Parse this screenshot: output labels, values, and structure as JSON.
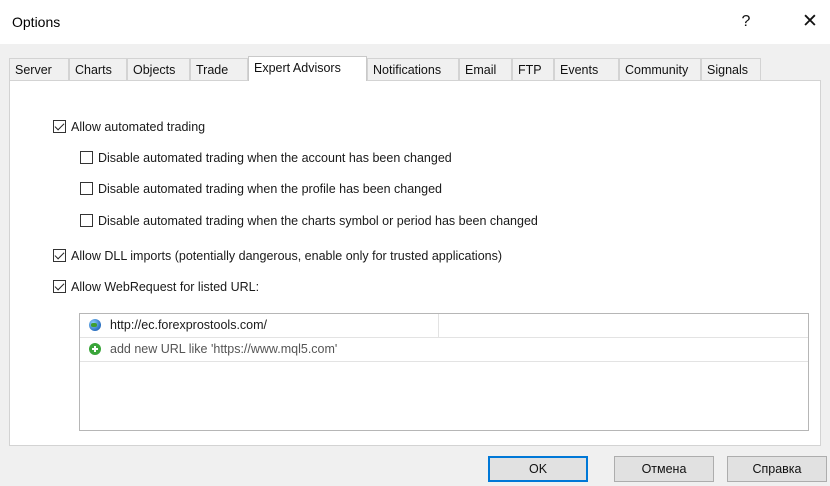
{
  "window": {
    "title": "Options",
    "help_label": "?",
    "close_label": "✕"
  },
  "tabs": [
    {
      "label": "Server"
    },
    {
      "label": "Charts"
    },
    {
      "label": "Objects"
    },
    {
      "label": "Trade"
    },
    {
      "label": "Expert Advisors",
      "active": true
    },
    {
      "label": "Notifications"
    },
    {
      "label": "Email"
    },
    {
      "label": "FTP"
    },
    {
      "label": "Events"
    },
    {
      "label": "Community"
    },
    {
      "label": "Signals"
    }
  ],
  "options": {
    "allow_automated": {
      "label": "Allow automated trading",
      "checked": true
    },
    "disable_account": {
      "label": "Disable automated trading when the account has been changed",
      "checked": false
    },
    "disable_profile": {
      "label": "Disable automated trading when the profile has been changed",
      "checked": false
    },
    "disable_symbol": {
      "label": "Disable automated trading when the charts symbol or period has been changed",
      "checked": false
    },
    "allow_dll": {
      "label": "Allow DLL imports (potentially dangerous, enable only for trusted applications)",
      "checked": true
    },
    "allow_webrequest": {
      "label": "Allow WebRequest for listed URL:",
      "checked": true
    }
  },
  "url_list": {
    "items": [
      {
        "url": "http://ec.forexprostools.com/",
        "icon": "globe-icon"
      }
    ],
    "add_new_label": "add new URL like 'https://www.mql5.com'",
    "add_icon": "add-icon"
  },
  "buttons": {
    "ok": "OK",
    "cancel": "Отмена",
    "help": "Справка"
  }
}
